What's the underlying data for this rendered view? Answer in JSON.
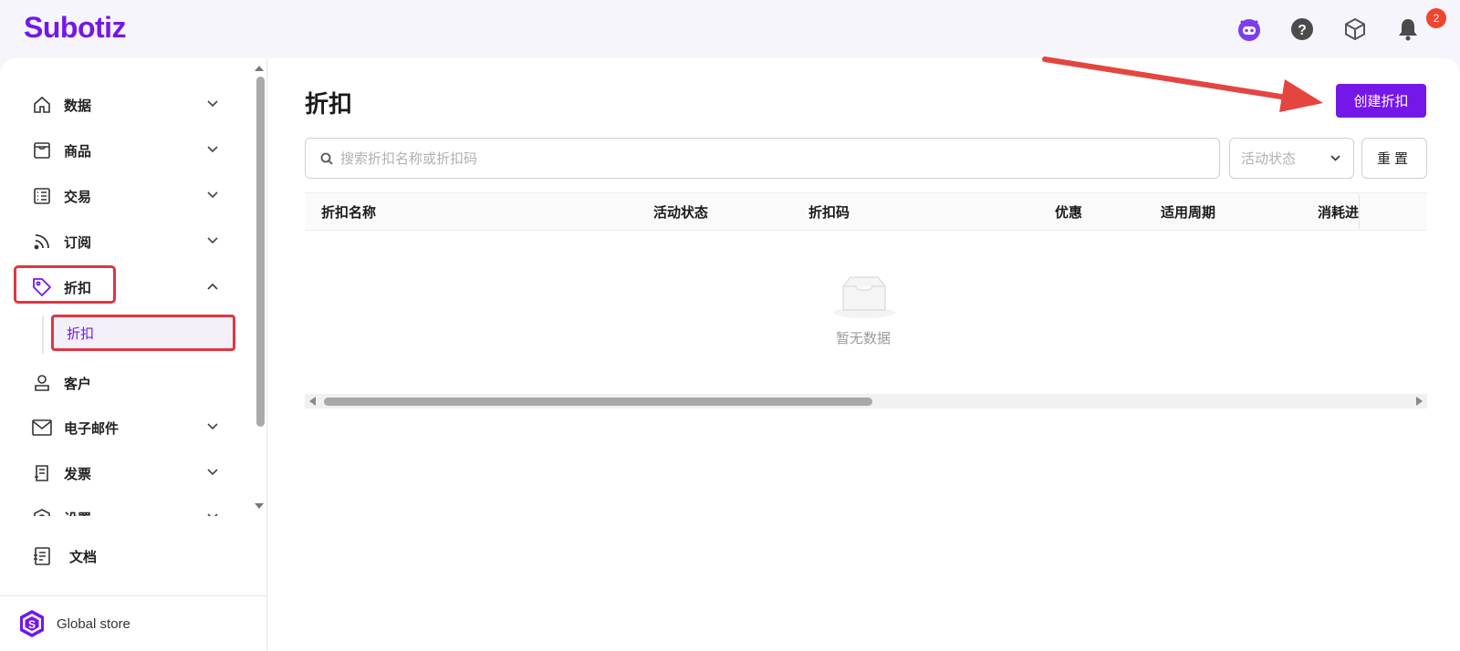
{
  "app": {
    "logo": "Subotiz",
    "notification_count": "2"
  },
  "sidebar": {
    "items": [
      {
        "label": "数据",
        "icon": "home-icon"
      },
      {
        "label": "商品",
        "icon": "store-icon"
      },
      {
        "label": "交易",
        "icon": "list-icon"
      },
      {
        "label": "订阅",
        "icon": "rss-icon"
      },
      {
        "label": "折扣",
        "icon": "tag-icon",
        "expanded": true
      },
      {
        "label": "客户",
        "icon": "user-icon"
      },
      {
        "label": "电子邮件",
        "icon": "mail-icon"
      },
      {
        "label": "发票",
        "icon": "receipt-icon"
      },
      {
        "label": "设置",
        "icon": "settings-icon"
      },
      {
        "label": "文档",
        "icon": "doc-icon"
      }
    ],
    "sub_item": "折扣",
    "store_name": "Global store",
    "store_avatar": "S"
  },
  "main": {
    "title": "折扣",
    "create_button": "创建折扣",
    "search_placeholder": "搜索折扣名称或折扣码",
    "status_placeholder": "活动状态",
    "reset_button": "重置",
    "columns": [
      "折扣名称",
      "活动状态",
      "折扣码",
      "优惠",
      "适用周期",
      "消耗进度"
    ],
    "empty_text": "暂无数据"
  },
  "colors": {
    "brand": "#7417e8",
    "highlight": "#e2353f",
    "badge": "#f0442d"
  }
}
